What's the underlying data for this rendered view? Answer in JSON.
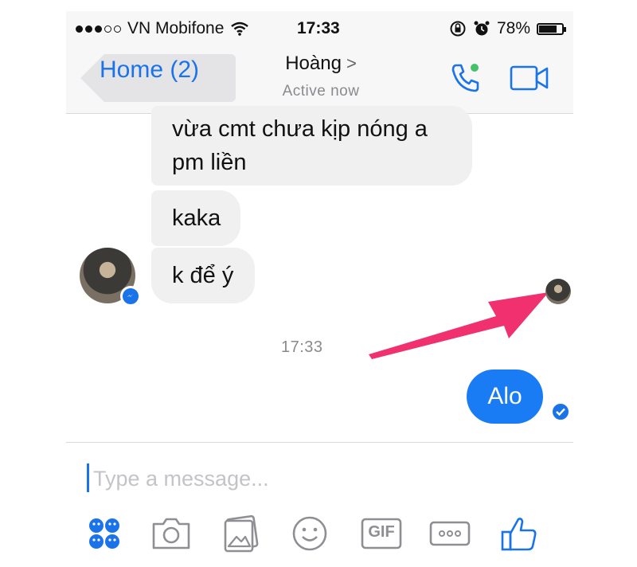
{
  "status_bar": {
    "carrier": "VN Mobifone",
    "time": "17:33",
    "battery_percent_text": "78%",
    "battery_level": 0.78,
    "icons": [
      "signal-dots-icon",
      "wifi-icon",
      "rotation-lock-icon",
      "alarm-icon",
      "battery-icon"
    ]
  },
  "nav": {
    "back_label": "Home (2)",
    "contact_name": "Hoàng",
    "chevron": ">",
    "status": "Active now",
    "icons": [
      "phone-icon",
      "video-icon"
    ]
  },
  "messages": [
    {
      "text_line1": "vừa cmt chưa kịp nóng a",
      "text_line2": "pm liền"
    },
    {
      "text": "kaka"
    },
    {
      "text": "k để ý"
    }
  ],
  "timestamp": "17:33",
  "outgoing": {
    "text": "Alo"
  },
  "composer": {
    "placeholder": "Type a message...",
    "tools": [
      "apps-icon",
      "camera-icon",
      "gallery-icon",
      "emoji-icon",
      "gif-icon",
      "more-icon",
      "like-icon"
    ],
    "gif_label": "GIF"
  },
  "colors": {
    "accent": "#1a73e8",
    "bubble_out": "#1a7cf5",
    "bubble_in": "#f1f0f0",
    "arrow": "#f0306f"
  }
}
